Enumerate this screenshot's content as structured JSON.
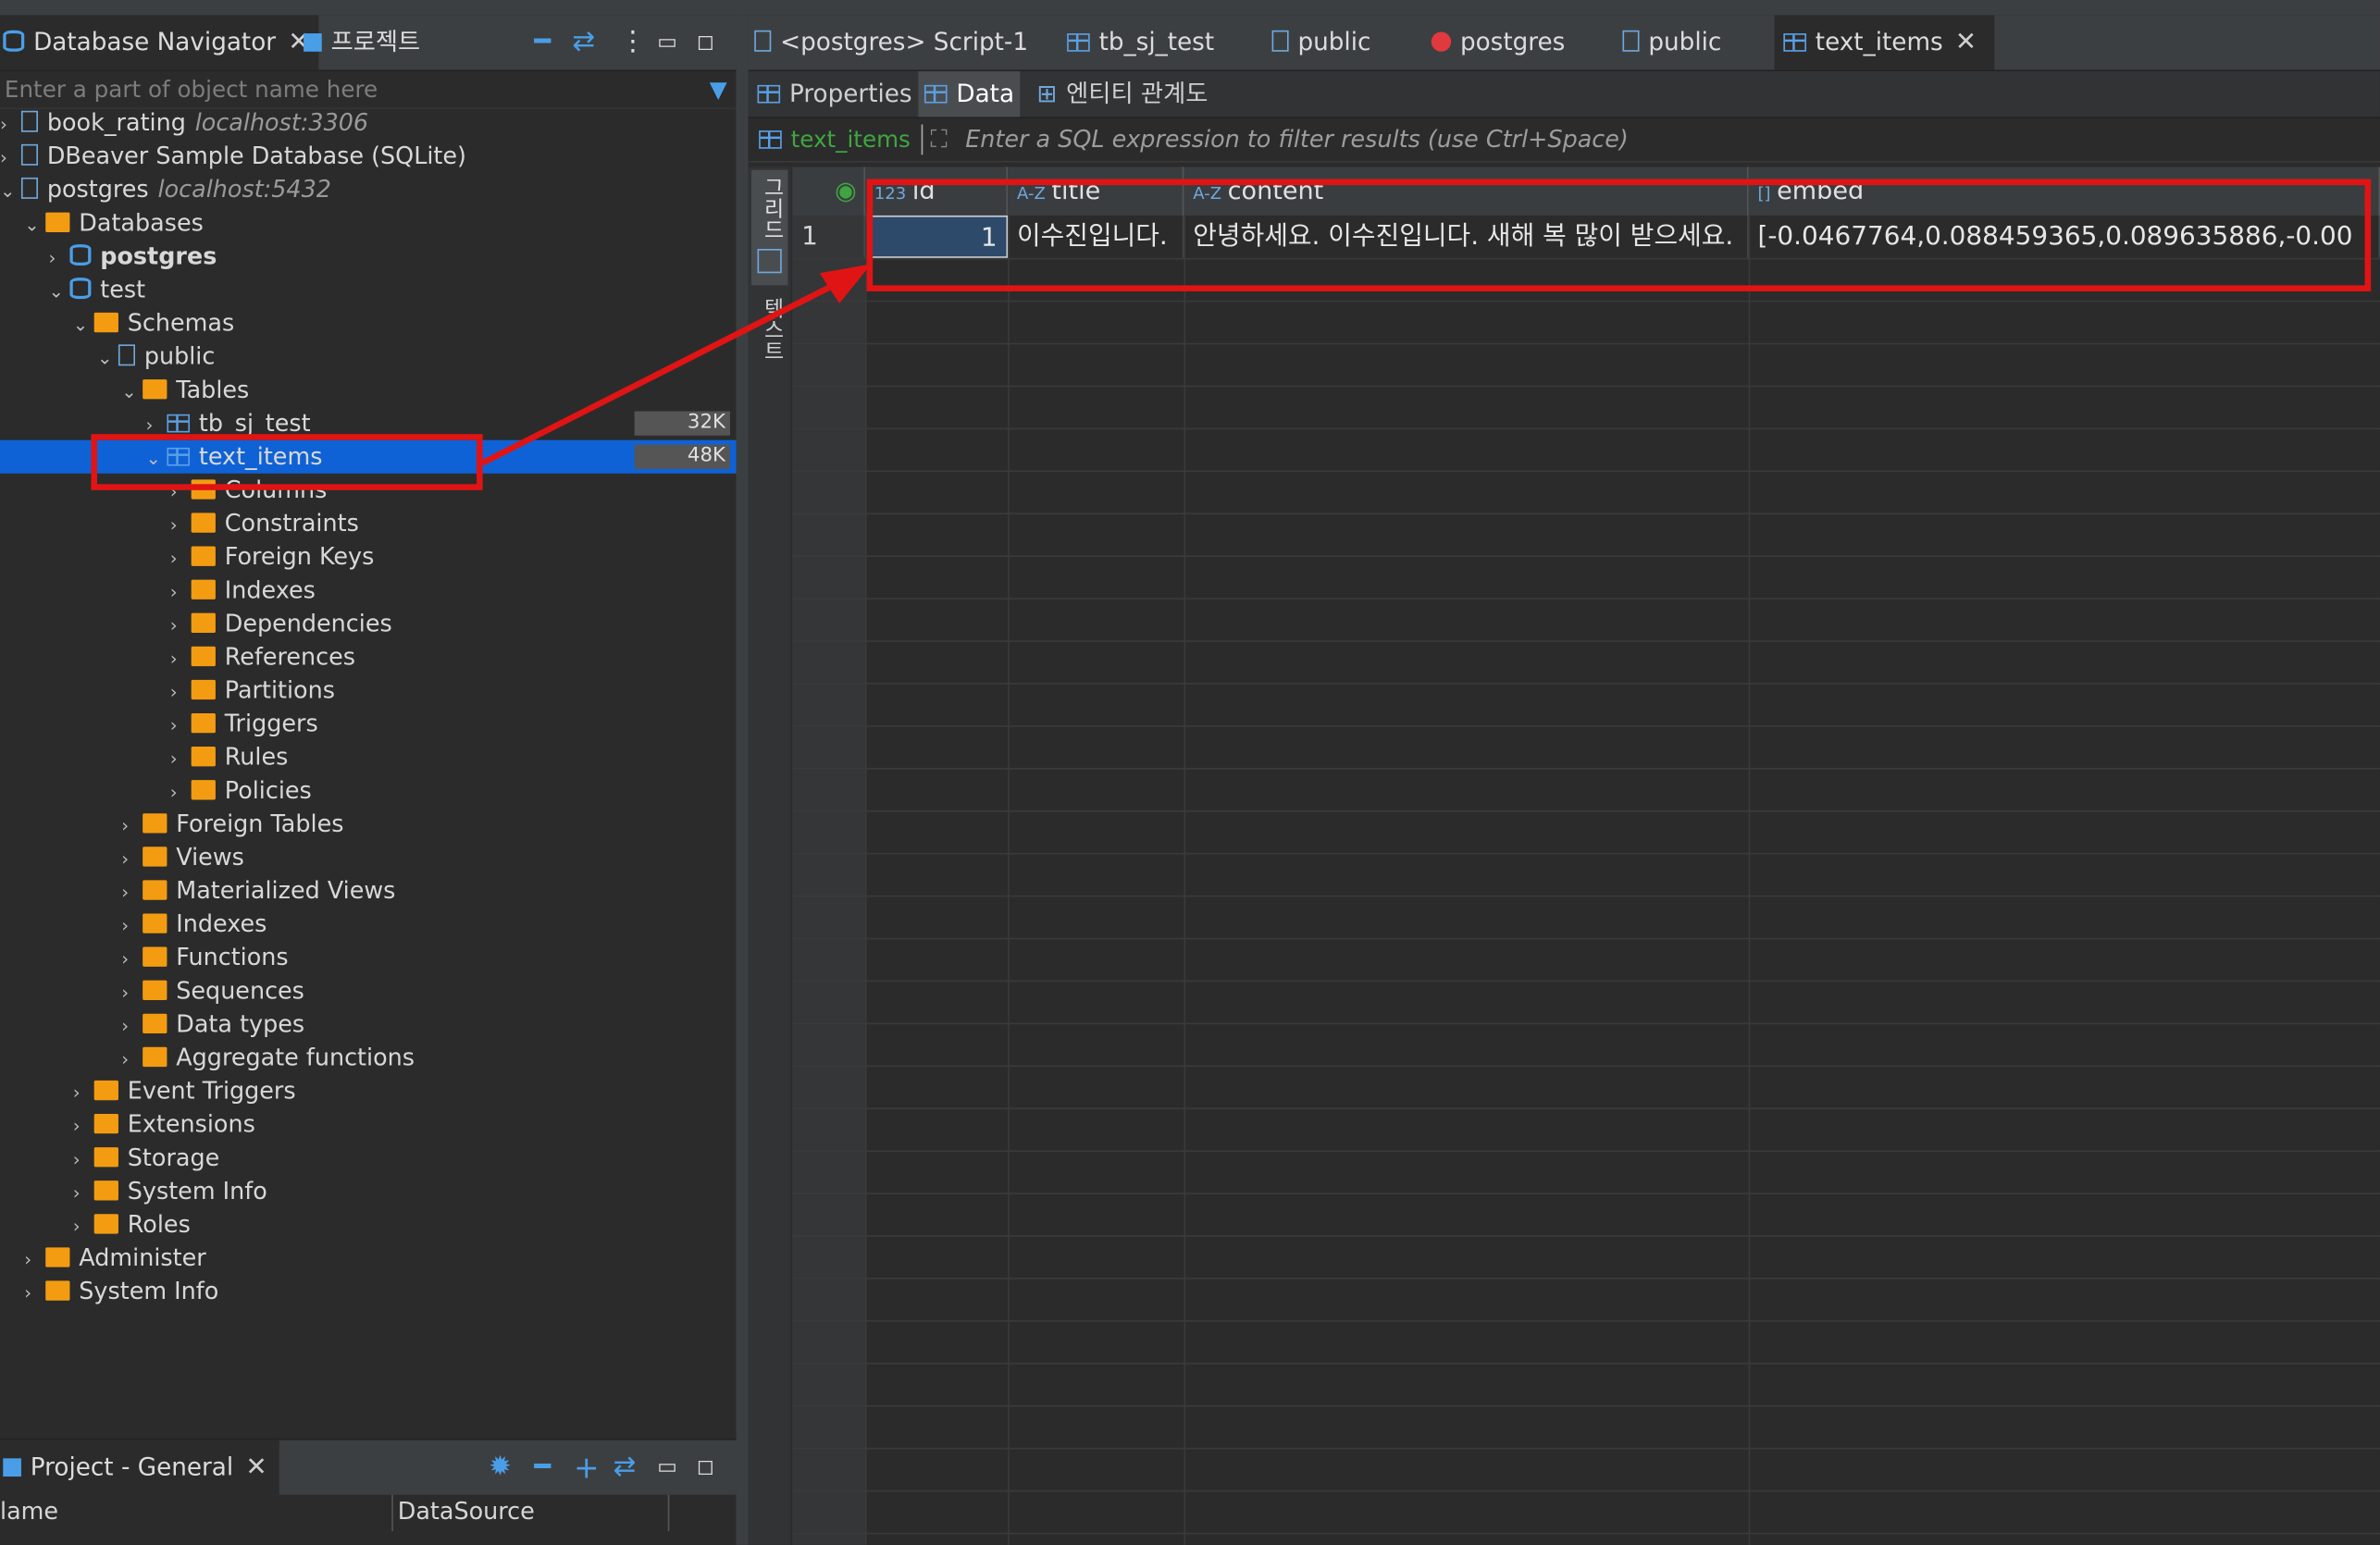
{
  "navigator": {
    "tab_label": "Database Navigator",
    "tab2_label": "프로젝트",
    "filter_placeholder": "Enter a part of object name here",
    "tree": [
      {
        "label": "book_rating",
        "host": "localhost:3306",
        "indent": 0,
        "chev": "›",
        "icon": "connection-mysql-icon"
      },
      {
        "label": "DBeaver Sample Database (SQLite)",
        "host": "",
        "indent": 0,
        "chev": "›",
        "icon": "connection-sqlite-icon"
      },
      {
        "label": "postgres",
        "host": "localhost:5432",
        "indent": 0,
        "chev": "⌄",
        "icon": "connection-postgres-icon"
      },
      {
        "label": "Databases",
        "indent": 1,
        "chev": "⌄",
        "icon": "databases-folder-icon"
      },
      {
        "label": "postgres",
        "indent": 2,
        "chev": "›",
        "icon": "database-icon",
        "bold": true
      },
      {
        "label": "test",
        "indent": 2,
        "chev": "⌄",
        "icon": "database-icon"
      },
      {
        "label": "Schemas",
        "indent": 3,
        "chev": "⌄",
        "icon": "schemas-folder-icon"
      },
      {
        "label": "public",
        "indent": 4,
        "chev": "⌄",
        "icon": "schema-icon"
      },
      {
        "label": "Tables",
        "indent": 5,
        "chev": "⌄",
        "icon": "tables-folder-icon"
      },
      {
        "label": "tb_sj_test",
        "indent": 6,
        "chev": "›",
        "icon": "table-icon",
        "size": "32K"
      },
      {
        "label": "text_items",
        "indent": 6,
        "chev": "⌄",
        "icon": "table-icon",
        "size": "48K",
        "selected": true
      },
      {
        "label": "Columns",
        "indent": 7,
        "chev": "›",
        "icon": "columns-folder-icon"
      },
      {
        "label": "Constraints",
        "indent": 7,
        "chev": "›",
        "icon": "constraints-folder-icon"
      },
      {
        "label": "Foreign Keys",
        "indent": 7,
        "chev": "›",
        "icon": "folder-icon"
      },
      {
        "label": "Indexes",
        "indent": 7,
        "chev": "›",
        "icon": "folder-icon"
      },
      {
        "label": "Dependencies",
        "indent": 7,
        "chev": "›",
        "icon": "folder-icon"
      },
      {
        "label": "References",
        "indent": 7,
        "chev": "›",
        "icon": "folder-icon"
      },
      {
        "label": "Partitions",
        "indent": 7,
        "chev": "›",
        "icon": "partitions-folder-icon"
      },
      {
        "label": "Triggers",
        "indent": 7,
        "chev": "›",
        "icon": "folder-icon"
      },
      {
        "label": "Rules",
        "indent": 7,
        "chev": "›",
        "icon": "folder-icon"
      },
      {
        "label": "Policies",
        "indent": 7,
        "chev": "›",
        "icon": "folder-icon"
      },
      {
        "label": "Foreign Tables",
        "indent": 5,
        "chev": "›",
        "icon": "foreign-tables-folder-icon"
      },
      {
        "label": "Views",
        "indent": 5,
        "chev": "›",
        "icon": "views-folder-icon"
      },
      {
        "label": "Materialized Views",
        "indent": 5,
        "chev": "›",
        "icon": "views-folder-icon"
      },
      {
        "label": "Indexes",
        "indent": 5,
        "chev": "›",
        "icon": "folder-icon"
      },
      {
        "label": "Functions",
        "indent": 5,
        "chev": "›",
        "icon": "folder-icon"
      },
      {
        "label": "Sequences",
        "indent": 5,
        "chev": "›",
        "icon": "folder-icon"
      },
      {
        "label": "Data types",
        "indent": 5,
        "chev": "›",
        "icon": "folder-icon"
      },
      {
        "label": "Aggregate functions",
        "indent": 5,
        "chev": "›",
        "icon": "folder-icon"
      },
      {
        "label": "Event Triggers",
        "indent": 3,
        "chev": "›",
        "icon": "folder-icon"
      },
      {
        "label": "Extensions",
        "indent": 3,
        "chev": "›",
        "icon": "extensions-folder-icon"
      },
      {
        "label": "Storage",
        "indent": 3,
        "chev": "›",
        "icon": "info-folder-icon"
      },
      {
        "label": "System Info",
        "indent": 3,
        "chev": "›",
        "icon": "info-folder-icon"
      },
      {
        "label": "Roles",
        "indent": 3,
        "chev": "›",
        "icon": "roles-folder-icon"
      },
      {
        "label": "Administer",
        "indent": 1,
        "chev": "›",
        "icon": "administer-folder-icon"
      },
      {
        "label": "System Info",
        "indent": 1,
        "chev": "›",
        "icon": "info-folder-icon"
      }
    ]
  },
  "project": {
    "tab_label": "Project - General",
    "col_name": "lame",
    "col_datasource": "DataSource"
  },
  "editor_tabs": [
    {
      "label": "<postgres> Script-1",
      "icon": "script-icon"
    },
    {
      "label": "tb_sj_test",
      "icon": "table-icon"
    },
    {
      "label": "public",
      "icon": "schema-icon"
    },
    {
      "label": "postgres",
      "icon": "error-icon"
    },
    {
      "label": "public",
      "icon": "schema-icon"
    },
    {
      "label": "text_items",
      "icon": "table-icon",
      "active": true
    }
  ],
  "sub_tabs": {
    "properties": "Properties",
    "data": "Data",
    "er": "엔티티 관계도"
  },
  "sqlbar": {
    "table_name": "text_items",
    "hint": "Enter a SQL expression to filter results (use Ctrl+Space)"
  },
  "side_strip": {
    "grid": "그리드",
    "text": "텍스트"
  },
  "grid": {
    "columns": [
      {
        "type": "123",
        "name": "id"
      },
      {
        "type": "A-Z",
        "name": "title"
      },
      {
        "type": "A-Z",
        "name": "content"
      },
      {
        "type": "[]",
        "name": "embed"
      }
    ],
    "rows": [
      {
        "num": "1",
        "id": "1",
        "title": "이수진입니다.",
        "content": "안녕하세요. 이수진입니다. 새해 복 많이 받으세요.",
        "embed": "[-0.0467764,0.088459365,0.089635886,-0.00"
      }
    ]
  },
  "colors": {
    "selection": "#0f62d6",
    "highlight": "#e01414",
    "accent": "#4a9ee8"
  }
}
